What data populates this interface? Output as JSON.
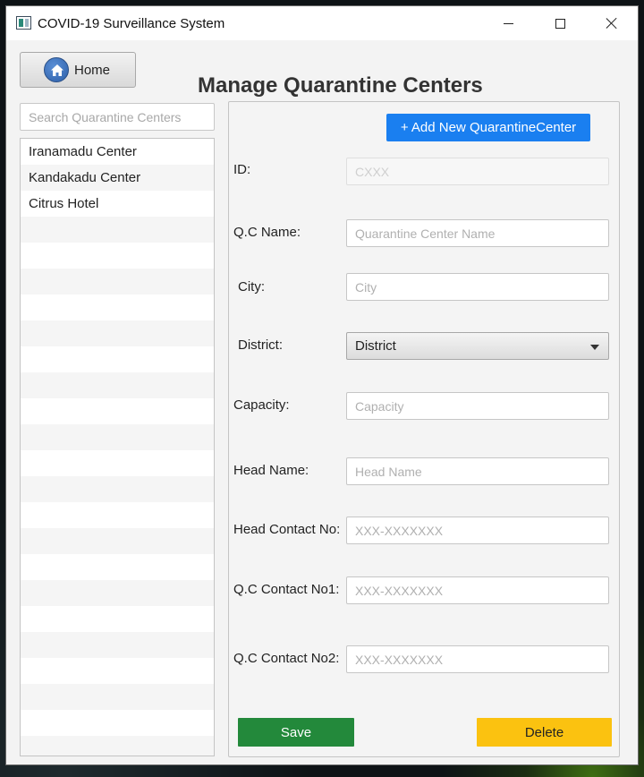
{
  "window": {
    "title": "COVID-19 Surveillance System"
  },
  "header": {
    "home_label": "Home",
    "page_title": "Manage Quarantine Centers"
  },
  "search": {
    "placeholder": "Search Quarantine Centers"
  },
  "centers": [
    "Iranamadu Center",
    "Kandakadu Center",
    "Citrus Hotel"
  ],
  "form": {
    "add_button": "+ Add New QuarantineCenter",
    "id": {
      "label": "ID:",
      "placeholder": "CXXX"
    },
    "name": {
      "label": "Q.C Name:",
      "placeholder": "Quarantine Center Name"
    },
    "city": {
      "label": "City:",
      "placeholder": "City"
    },
    "district": {
      "label": "District:",
      "selected": "District"
    },
    "capacity": {
      "label": "Capacity:",
      "placeholder": "Capacity"
    },
    "head_name": {
      "label": "Head Name:",
      "placeholder": "Head Name"
    },
    "head_contact": {
      "label": "Head Contact No:",
      "placeholder": "XXX-XXXXXXX"
    },
    "qc_contact1": {
      "label": "Q.C Contact No1:",
      "placeholder": "XXX-XXXXXXX"
    },
    "qc_contact2": {
      "label": "Q.C Contact No2:",
      "placeholder": "XXX-XXXXXXX"
    },
    "save_label": "Save",
    "delete_label": "Delete"
  },
  "colors": {
    "add_button": "#1a7ff0",
    "save_button": "#23893b",
    "delete_button": "#fbc210"
  }
}
